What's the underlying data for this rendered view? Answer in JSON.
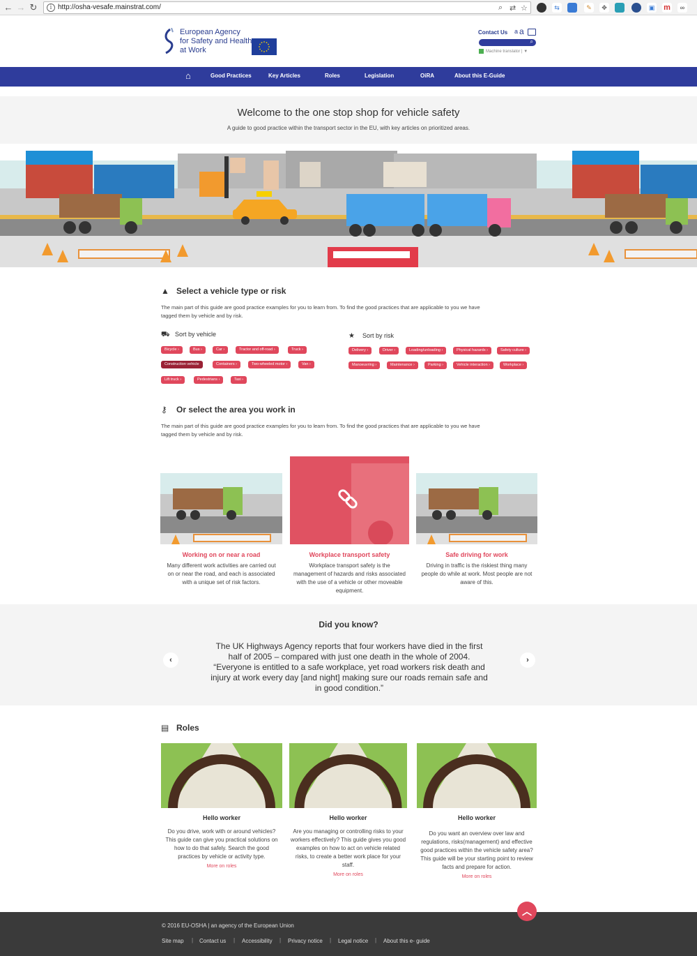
{
  "browser": {
    "url": "http://osha-vesafe.mainstrat.com/"
  },
  "header": {
    "agency_name_line1": "European Agency",
    "agency_name_line2": "for Safety and Health",
    "agency_name_line3": "at Work",
    "contact": "Contact Us",
    "text_small": "a",
    "text_large": "a",
    "search_placeholder": "",
    "machine_translator": "Machine translator"
  },
  "nav": {
    "items": [
      "Good Practices",
      "Key Articles",
      "Roles",
      "Legislation",
      "OiRA",
      "About this E-Guide"
    ]
  },
  "welcome": {
    "title": "Welcome to the one stop shop for vehicle safety",
    "subtitle": "A guide to good practice within the transport sector in the EU, with key articles on prioritized areas."
  },
  "select_vehicle": {
    "title": "Select a vehicle type or risk",
    "intro_line1": "The main part of this guide are good practice examples for you to learn from. To find the good practices that are applicable to you we have",
    "intro_line2": "tagged them by vehicle and by risk.",
    "sort_vehicle": "Sort by vehicle",
    "sort_risk": "Sort by risk",
    "vehicle_tags": [
      "Bicycle",
      "Bus",
      "Car",
      "Tractor and off-road",
      "Truck",
      "Construction vehicle",
      "Containers",
      "Two-wheeled motor",
      "Van",
      "Lift truck",
      "Pedestrians",
      "Taxi"
    ],
    "risk_tags": [
      "Delivery",
      "Driver",
      "Loading/unloading",
      "Physical hazards",
      "Safety culture",
      "Manoeuvring",
      "Maintenance",
      "Parking",
      "Vehicle interaction",
      "Workplace"
    ]
  },
  "select_area": {
    "title": "Or select the area you work in",
    "intro_line1": "The main part of this guide are good practice examples for you to learn from. To find the good practices that are applicable to you we have",
    "intro_line2": "tagged them by vehicle and by risk.",
    "cards": [
      {
        "title": "Working on or near a road",
        "lines": [
          "Many different work activities are carried out",
          "on or near the road, and each is associated",
          "with a unique set of risk factors."
        ]
      },
      {
        "title": "Workplace transport safety",
        "lines": [
          "Workplace transport safety is the",
          "management of hazards and risks associated",
          "with the use of a vehicle or other moveable",
          "equipment."
        ]
      },
      {
        "title": "Safe driving for work",
        "lines": [
          "Driving in traffic is the riskiest thing many",
          "people do while at work. Most people are not",
          "aware of this."
        ]
      }
    ]
  },
  "did_you_know": {
    "title": "Did you know?",
    "lines": [
      "The UK Highways Agency reports that four workers have died in the first",
      "half of 2005 – compared with just one death in the whole of 2004.",
      "“Everyone is entitled to a safe workplace, yet road workers risk death and",
      "injury at work every day [and night] making sure our roads remain safe and",
      "in good condition.”"
    ],
    "prev": "‹",
    "next": "›"
  },
  "roles": {
    "title": "Roles",
    "cards": [
      {
        "title": "Hello worker",
        "lines": [
          "Do you drive, work with or around vehicles?",
          "This guide can give you practical solutions on",
          "how to do that safely. Search the good",
          "practices by vehicle or activity type."
        ],
        "more": "More on roles"
      },
      {
        "title": "Hello worker",
        "lines": [
          "Are you managing or controlling risks to your",
          "workers effectively? This guide gives you good",
          "examples on how to act on vehicle related",
          "risks, to create a better work place for your",
          "staff."
        ],
        "more": "More on roles"
      },
      {
        "title": "Hello worker",
        "lines": [
          "Do you want an overview over law and",
          "regulations, risks(management) and effective",
          "good practices within the vehicle safety area?",
          "This guide will be your starting point to review",
          "facts and prepare for action."
        ],
        "more": "More on roles"
      }
    ]
  },
  "footer": {
    "copyright": "© 2016 EU-OSHA | an  agency of the European Union",
    "links": [
      "Site map",
      "Contact us",
      "Accessibility",
      "Privacy notice",
      "Legal notice",
      "About this e- guide"
    ]
  },
  "colors": {
    "nav_blue": "#2f3c9c",
    "accent_red": "#e0475c",
    "footer_dark": "#3a3a3a"
  }
}
